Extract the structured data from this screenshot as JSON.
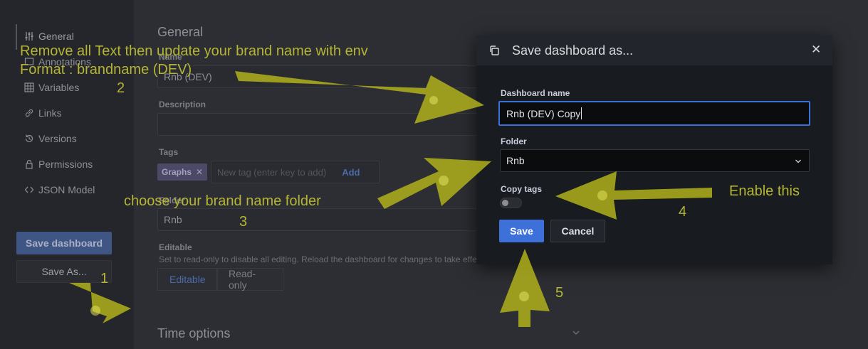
{
  "sidebar": {
    "items": [
      {
        "label": "General",
        "icon": "sliders-icon"
      },
      {
        "label": "Annotations",
        "icon": "annotation-icon"
      },
      {
        "label": "Variables",
        "icon": "variables-icon"
      },
      {
        "label": "Links",
        "icon": "link-icon"
      },
      {
        "label": "Versions",
        "icon": "history-icon"
      },
      {
        "label": "Permissions",
        "icon": "lock-icon"
      },
      {
        "label": "JSON Model",
        "icon": "code-icon"
      }
    ],
    "save_dashboard_label": "Save dashboard",
    "save_as_label": "Save As..."
  },
  "settings": {
    "general_title": "General",
    "name_label": "Name",
    "name_value": "Rnb (DEV)",
    "description_label": "Description",
    "description_value": "",
    "tags_label": "Tags",
    "tag_chip": "Graphs",
    "tag_placeholder": "New tag (enter key to add)",
    "add_label": "Add",
    "folder_label": "Folder",
    "folder_value": "Rnb",
    "editable_label": "Editable",
    "editable_help": "Set to read-only to disable all editing. Reload the dashboard for changes to take effect",
    "editable_option": "Editable",
    "readonly_option": "Read-only",
    "time_options_title": "Time options"
  },
  "modal": {
    "title": "Save dashboard as...",
    "dashboard_name_label": "Dashboard name",
    "dashboard_name_value": "Rnb (DEV) Copy",
    "folder_label": "Folder",
    "folder_value": "Rnb",
    "copy_tags_label": "Copy tags",
    "copy_tags_enabled": false,
    "save_label": "Save",
    "cancel_label": "Cancel"
  },
  "annotations": {
    "instruction_1": "Remove all Text then update your brand name with env",
    "instruction_2": "Format : brandname (DEV)",
    "folder_instruction": "choose your brand name folder",
    "enable_instruction": "Enable this",
    "step_1": "1",
    "step_2": "2",
    "step_3": "3",
    "step_4": "4",
    "step_5": "5"
  },
  "colors": {
    "primary": "#3d71d9",
    "annotation": "#b5b535",
    "background": "#2d2e33",
    "modal_bg": "#181b1f"
  }
}
